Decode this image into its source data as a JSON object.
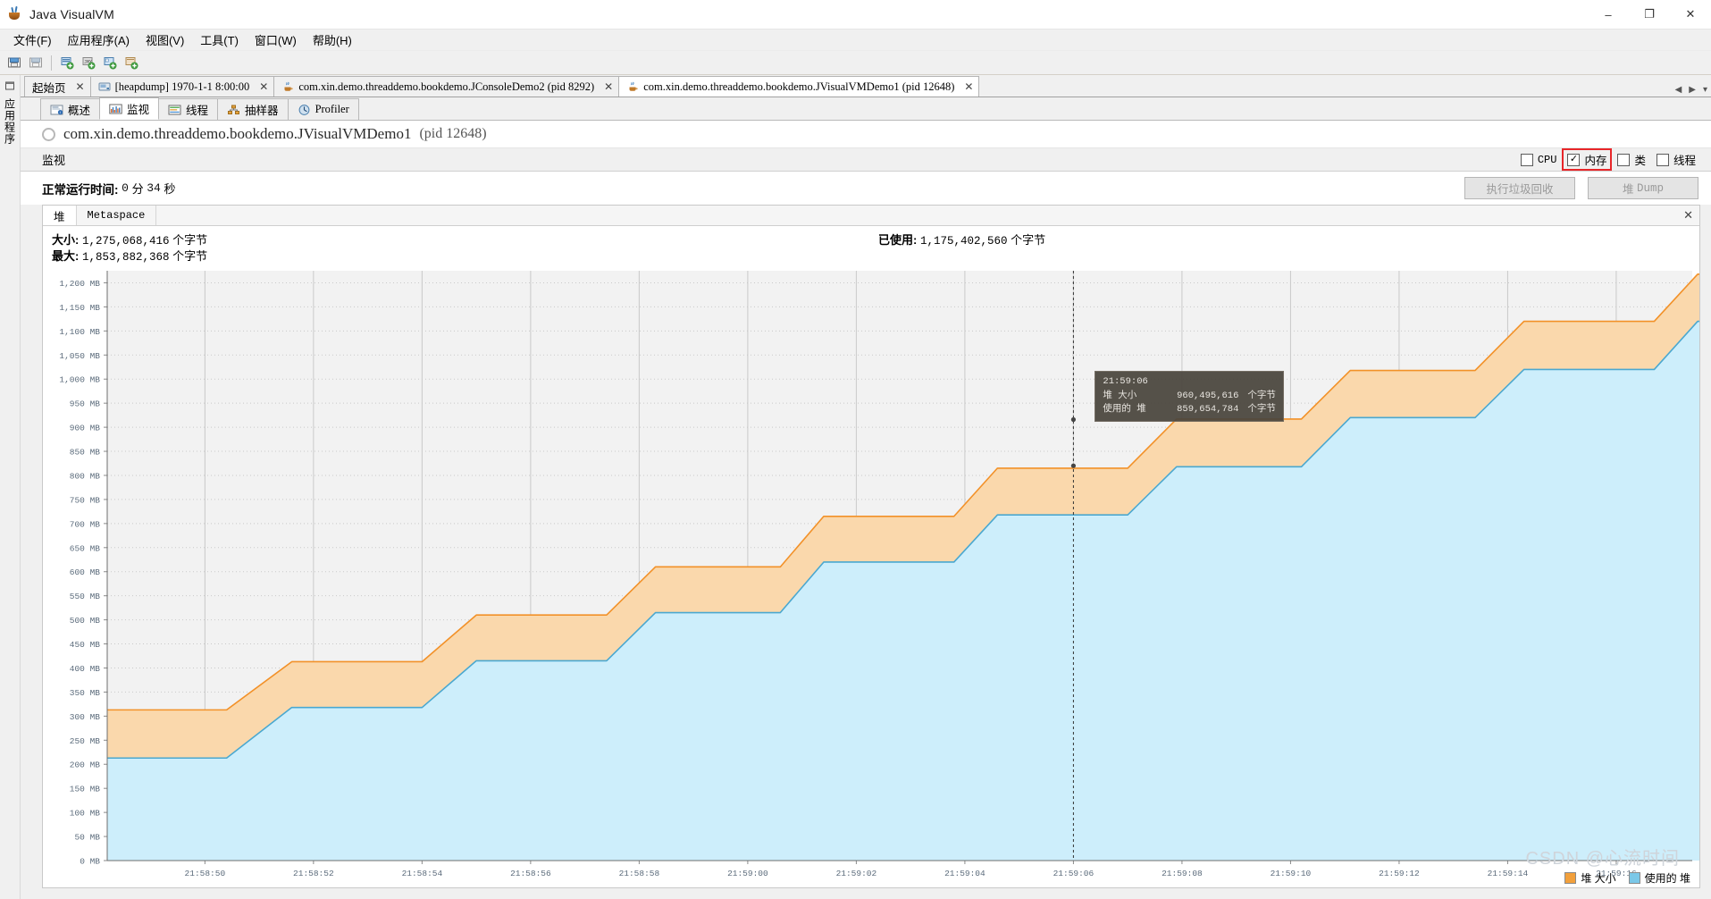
{
  "window": {
    "title": "Java VisualVM",
    "icon": "java-coffee-icon",
    "controls": {
      "minimize": "–",
      "maximize": "❐",
      "close": "✕"
    }
  },
  "menubar": {
    "items": [
      {
        "label": "文件(F)",
        "name": "menu-file"
      },
      {
        "label": "应用程序(A)",
        "name": "menu-applications"
      },
      {
        "label": "视图(V)",
        "name": "menu-view"
      },
      {
        "label": "工具(T)",
        "name": "menu-tools"
      },
      {
        "label": "窗口(W)",
        "name": "menu-window"
      },
      {
        "label": "帮助(H)",
        "name": "menu-help"
      }
    ]
  },
  "toolbar": {
    "buttons": [
      {
        "name": "open-snapshot-icon"
      },
      {
        "name": "save-snapshot-icon"
      },
      {
        "name": "add-jmx-connection-icon"
      },
      {
        "name": "add-jmx-host-icon"
      },
      {
        "name": "add-remote-host-icon"
      },
      {
        "name": "add-application-icon"
      }
    ]
  },
  "left_rail": {
    "pin": "pin-icon",
    "label": "应用程序"
  },
  "doc_tabs": [
    {
      "label": "起始页",
      "icon": "",
      "active": false,
      "closable": true
    },
    {
      "label": "[heapdump] 1970-1-1 8:00:00",
      "icon": "heapdump-icon",
      "active": false,
      "closable": true
    },
    {
      "label": "com.xin.demo.threaddemo.bookdemo.JConsoleDemo2 (pid 8292)",
      "icon": "java-app-icon",
      "active": false,
      "closable": true
    },
    {
      "label": "com.xin.demo.threaddemo.bookdemo.JVisualVMDemo1 (pid 12648)",
      "icon": "java-app-icon",
      "active": true,
      "closable": true
    }
  ],
  "view_tabs": [
    {
      "label": "概述",
      "icon": "overview-icon",
      "active": false
    },
    {
      "label": "监视",
      "icon": "monitor-icon",
      "active": true
    },
    {
      "label": "线程",
      "icon": "threads-icon",
      "active": false
    },
    {
      "label": "抽样器",
      "icon": "sampler-icon",
      "active": false
    },
    {
      "label": "Profiler",
      "icon": "profiler-icon",
      "active": false
    }
  ],
  "app_header": {
    "name": "com.xin.demo.threaddemo.bookdemo.JVisualVMDemo1",
    "pid": "(pid 12648)",
    "status_icon": "idle-ring-icon"
  },
  "monitor_bar": {
    "label": "监视",
    "checkboxes": [
      {
        "label": "CPU",
        "checked": false,
        "name": "checkbox-cpu",
        "mono": true
      },
      {
        "label": "内存",
        "checked": true,
        "name": "checkbox-memory",
        "mono": false,
        "highlighted": true
      },
      {
        "label": "类",
        "checked": false,
        "name": "checkbox-classes",
        "mono": false
      },
      {
        "label": "线程",
        "checked": false,
        "name": "checkbox-threads",
        "mono": false
      }
    ]
  },
  "uptime": {
    "label": "正常运行时间:",
    "minutes": "0",
    "minutes_unit": "分",
    "seconds": "34",
    "seconds_unit": "秒"
  },
  "actions": {
    "gc_label": "执行垃圾回收",
    "heapdump_label_cn": "堆",
    "heapdump_label_en": "Dump",
    "disabled": true
  },
  "panel": {
    "tabs": [
      {
        "label": "堆",
        "active": true,
        "mono": false
      },
      {
        "label": "Metaspace",
        "active": false,
        "mono": true
      }
    ],
    "close": "✕",
    "stats": {
      "size_label": "大小:",
      "size_value": "1,275,068,416",
      "max_label": "最大:",
      "max_value": "1,853,882,368",
      "used_label": "已使用:",
      "used_value": "1,175,402,560",
      "unit": "个字节"
    }
  },
  "tooltip": {
    "time": "21:59:06",
    "rows": [
      {
        "key": "堆 大小",
        "value": "960,495,616",
        "unit": "个字节"
      },
      {
        "key": "使用的 堆",
        "value": "859,654,784",
        "unit": "个字节"
      }
    ]
  },
  "legend": [
    {
      "label": "堆 大小",
      "color": "#f2a03c"
    },
    {
      "label": "使用的 堆",
      "color": "#7bc8e8"
    }
  ],
  "watermark": "CSDN @心流时间",
  "chart_data": {
    "type": "area",
    "title": "",
    "xlabel": "",
    "ylabel": "",
    "ylim": [
      0,
      1225
    ],
    "y_unit": "MB",
    "y_ticks": [
      0,
      50,
      100,
      150,
      200,
      250,
      300,
      350,
      400,
      450,
      500,
      550,
      600,
      650,
      700,
      750,
      800,
      850,
      900,
      950,
      1000,
      1050,
      1100,
      1150,
      1200
    ],
    "y_tick_labels": [
      "0 MB",
      "50 MB",
      "100 MB",
      "150 MB",
      "200 MB",
      "250 MB",
      "300 MB",
      "350 MB",
      "400 MB",
      "450 MB",
      "500 MB",
      "550 MB",
      "600 MB",
      "650 MB",
      "700 MB",
      "750 MB",
      "800 MB",
      "850 MB",
      "900 MB",
      "950 MB",
      "1,000 MB",
      "1,050 MB",
      "1,100 MB",
      "1,150 MB",
      "1,200 MB"
    ],
    "x_tick_labels": [
      "21:58:50",
      "21:58:52",
      "21:58:54",
      "21:58:56",
      "21:58:58",
      "21:59:00",
      "21:59:02",
      "21:59:04",
      "21:59:06",
      "21:59:08",
      "21:59:10",
      "21:59:12",
      "21:59:14",
      "21:59:16"
    ],
    "x_range_seconds": [
      48.2,
      17.4
    ],
    "grid": true,
    "legend_position": "bottom-right",
    "cursor_time": "21:59:06",
    "series": [
      {
        "name": "堆 大小",
        "color": "#f29128",
        "fill": "#fad8ac",
        "points": [
          [
            48.2,
            313
          ],
          [
            49.2,
            313
          ],
          [
            50.4,
            313
          ],
          [
            51.6,
            413
          ],
          [
            53.2,
            413
          ],
          [
            54.0,
            413
          ],
          [
            55.0,
            510
          ],
          [
            56.6,
            510
          ],
          [
            57.4,
            510
          ],
          [
            58.3,
            610
          ],
          [
            59.5,
            610
          ],
          [
            60.6,
            610
          ],
          [
            61.4,
            715
          ],
          [
            62.9,
            715
          ],
          [
            63.8,
            715
          ],
          [
            64.6,
            815
          ],
          [
            66.2,
            815
          ],
          [
            67.0,
            815
          ],
          [
            67.9,
            917
          ],
          [
            69.4,
            917
          ],
          [
            70.2,
            917
          ],
          [
            71.1,
            1018
          ],
          [
            72.6,
            1018
          ],
          [
            73.4,
            1018
          ],
          [
            74.3,
            1120
          ],
          [
            75.8,
            1120
          ],
          [
            76.7,
            1120
          ],
          [
            77.5,
            1218
          ],
          [
            79.0,
            1218
          ],
          [
            80.5,
            1218
          ]
        ]
      },
      {
        "name": "使用的 堆",
        "color": "#4aa8d0",
        "fill": "#cdeefb",
        "points": [
          [
            48.2,
            213
          ],
          [
            49.2,
            213
          ],
          [
            50.4,
            213
          ],
          [
            51.6,
            318
          ],
          [
            53.2,
            318
          ],
          [
            54.0,
            318
          ],
          [
            55.0,
            415
          ],
          [
            56.6,
            415
          ],
          [
            57.4,
            415
          ],
          [
            58.3,
            515
          ],
          [
            59.5,
            515
          ],
          [
            60.6,
            515
          ],
          [
            61.4,
            620
          ],
          [
            62.9,
            620
          ],
          [
            63.8,
            620
          ],
          [
            64.6,
            718
          ],
          [
            66.2,
            718
          ],
          [
            67.0,
            718
          ],
          [
            67.9,
            818
          ],
          [
            69.4,
            818
          ],
          [
            70.2,
            818
          ],
          [
            71.1,
            920
          ],
          [
            72.6,
            920
          ],
          [
            73.4,
            920
          ],
          [
            74.3,
            1020
          ],
          [
            75.8,
            1020
          ],
          [
            76.7,
            1020
          ],
          [
            77.5,
            1120
          ],
          [
            79.0,
            1120
          ],
          [
            80.5,
            1120
          ]
        ]
      }
    ],
    "cursor_point_values": {
      "heap_size_mb": 916,
      "heap_used_mb": 820
    }
  }
}
